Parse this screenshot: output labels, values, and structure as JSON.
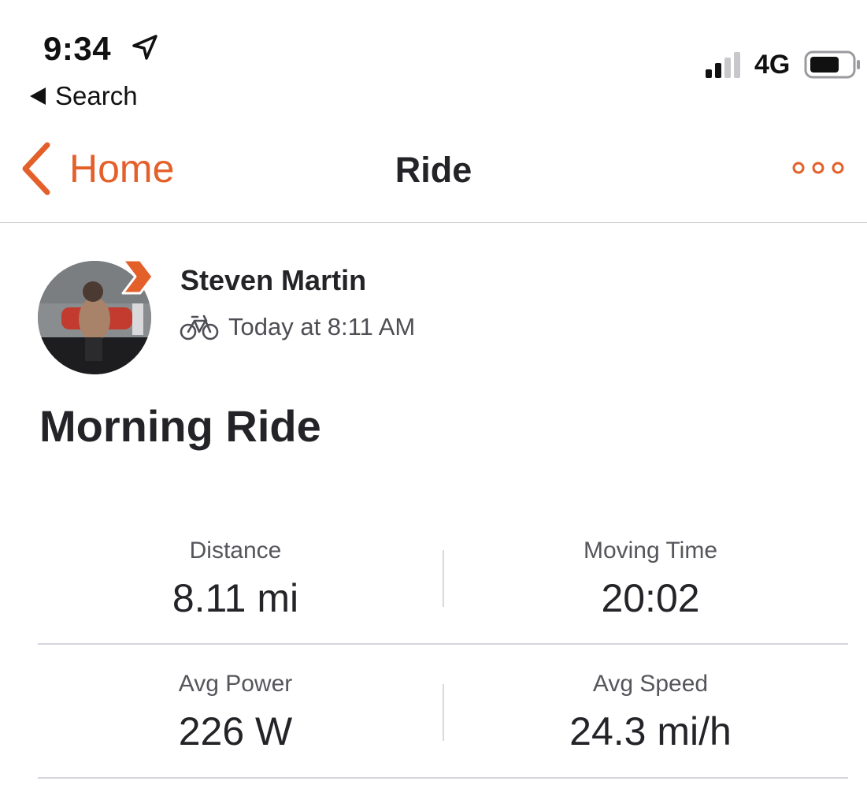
{
  "status_bar": {
    "time": "9:34",
    "back_to_app": "Search",
    "network": "4G"
  },
  "nav": {
    "back_label": "Home",
    "title": "Ride"
  },
  "athlete": {
    "name": "Steven Martin",
    "activity_time": "Today at 8:11 AM"
  },
  "activity": {
    "title": "Morning Ride"
  },
  "stats": [
    {
      "label": "Distance",
      "value": "8.11 mi"
    },
    {
      "label": "Moving Time",
      "value": "20:02"
    },
    {
      "label": "Avg Power",
      "value": "226 W"
    },
    {
      "label": "Avg Speed",
      "value": "24.3 mi/h"
    }
  ],
  "colors": {
    "accent": "#e4602b",
    "text_primary": "#242428"
  }
}
